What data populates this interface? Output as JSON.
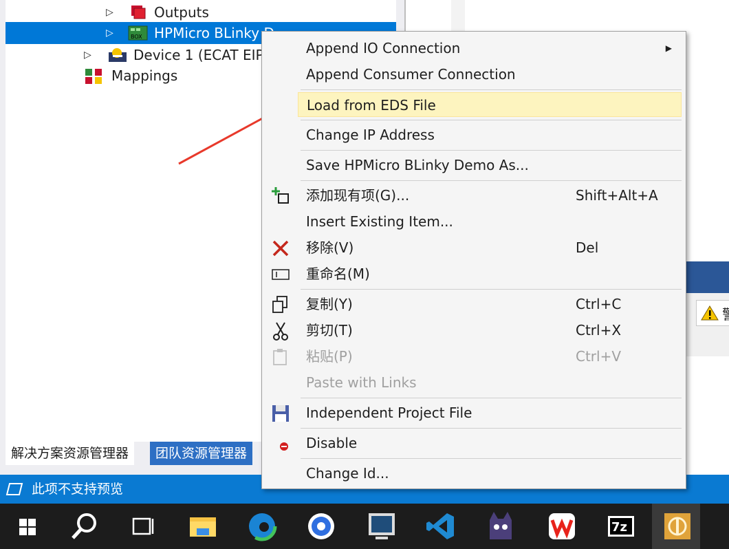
{
  "explorer": {
    "tree": [
      {
        "label": "Outputs",
        "selected": false,
        "icon": "outputs-icon"
      },
      {
        "label": "HPMicro BLinky D",
        "selected": true,
        "icon": "box-device-icon"
      },
      {
        "label": "Device 1 (ECAT EIP",
        "selected": false,
        "icon": "device-icon"
      },
      {
        "label": "Mappings",
        "selected": false,
        "icon": "mappings-icon"
      }
    ],
    "tabs": {
      "solution": "解决方案资源管理器",
      "team": "团队资源管理器"
    }
  },
  "right_panel": {
    "warning_text": "警"
  },
  "status": {
    "text": "此项不支持预览"
  },
  "menu": {
    "items": [
      {
        "label": "Append IO Connection",
        "shortcut": "",
        "submenu": true
      },
      {
        "label": "Append Consumer Connection",
        "shortcut": ""
      },
      {
        "label": "Load from EDS File",
        "shortcut": "",
        "highlighted": true
      },
      {
        "label": "Change IP Address",
        "shortcut": ""
      },
      {
        "label": "Save HPMicro BLinky Demo As...",
        "shortcut": ""
      },
      {
        "label": "添加现有项(G)...",
        "shortcut": "Shift+Alt+A",
        "icon": "add-item-icon"
      },
      {
        "label": "Insert Existing Item...",
        "shortcut": ""
      },
      {
        "label": "移除(V)",
        "shortcut": "Del",
        "icon": "remove-icon"
      },
      {
        "label": "重命名(M)",
        "shortcut": "",
        "icon": "rename-icon"
      },
      {
        "label": "复制(Y)",
        "shortcut": "Ctrl+C",
        "icon": "copy-icon"
      },
      {
        "label": "剪切(T)",
        "shortcut": "Ctrl+X",
        "icon": "cut-icon"
      },
      {
        "label": "粘贴(P)",
        "shortcut": "Ctrl+V",
        "icon": "paste-icon",
        "disabled": true
      },
      {
        "label": "Paste with Links",
        "shortcut": "",
        "disabled": true
      },
      {
        "label": "Independent Project File",
        "shortcut": "",
        "icon": "save-icon"
      },
      {
        "label": "Disable",
        "shortcut": "",
        "icon": "disable-icon"
      },
      {
        "label": "Change Id...",
        "shortcut": ""
      }
    ]
  },
  "taskbar": {
    "icons": [
      "windows-start-icon",
      "search-icon",
      "task-view-icon",
      "file-explorer-icon",
      "edge-icon",
      "browser-icon",
      "monitor-app-icon",
      "vscode-icon",
      "cat-app-icon",
      "wps-icon",
      "7zip-icon",
      "twincat-icon"
    ]
  },
  "colors": {
    "accent": "#0078d7",
    "highlight": "#fdf4bf",
    "annotation_arrow": "#e8392b"
  }
}
